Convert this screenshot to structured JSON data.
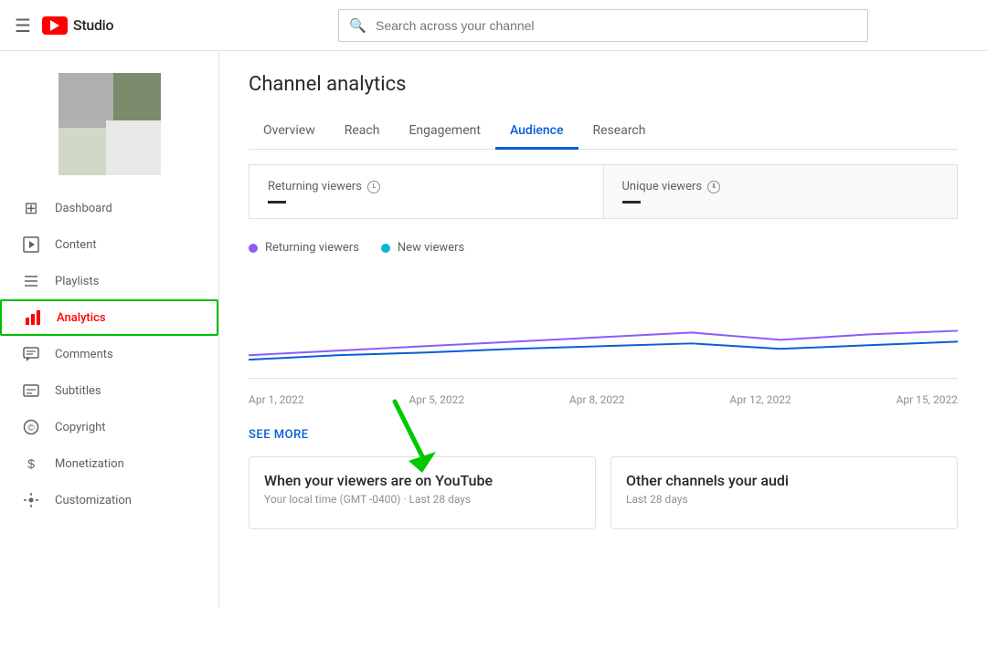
{
  "header": {
    "hamburger_label": "☰",
    "logo_text": "Studio",
    "search_placeholder": "Search across your channel"
  },
  "sidebar": {
    "nav_items": [
      {
        "id": "dashboard",
        "label": "Dashboard",
        "icon": "⊞",
        "active": false
      },
      {
        "id": "content",
        "label": "Content",
        "icon": "▷",
        "active": false
      },
      {
        "id": "playlists",
        "label": "Playlists",
        "icon": "≡",
        "active": false
      },
      {
        "id": "analytics",
        "label": "Analytics",
        "icon": "📊",
        "active": true
      },
      {
        "id": "comments",
        "label": "Comments",
        "icon": "💬",
        "active": false
      },
      {
        "id": "subtitles",
        "label": "Subtitles",
        "icon": "⊟",
        "active": false
      },
      {
        "id": "copyright",
        "label": "Copyright",
        "icon": "©",
        "active": false
      },
      {
        "id": "monetization",
        "label": "Monetization",
        "icon": "$",
        "active": false
      },
      {
        "id": "customization",
        "label": "Customization",
        "icon": "✦",
        "active": false
      }
    ]
  },
  "main": {
    "page_title": "Channel analytics",
    "tabs": [
      {
        "id": "overview",
        "label": "Overview",
        "active": false
      },
      {
        "id": "reach",
        "label": "Reach",
        "active": false
      },
      {
        "id": "engagement",
        "label": "Engagement",
        "active": false
      },
      {
        "id": "audience",
        "label": "Audience",
        "active": true
      },
      {
        "id": "research",
        "label": "Research",
        "active": false
      }
    ],
    "metrics": [
      {
        "label": "Returning viewers",
        "value": "—"
      },
      {
        "label": "Unique viewers",
        "value": "—"
      }
    ],
    "legend": [
      {
        "label": "Returning viewers",
        "color": "#8b5cf6"
      },
      {
        "label": "New viewers",
        "color": "#06b6d4"
      }
    ],
    "x_axis_labels": [
      "Apr 1, 2022",
      "Apr 5, 2022",
      "Apr 8, 2022",
      "Apr 12, 2022",
      "Apr 15, 2022"
    ],
    "see_more_label": "SEE MORE",
    "bottom_cards": [
      {
        "title": "When your viewers are on YouTube",
        "subtitle": "Your local time (GMT -0400) · Last 28 days"
      },
      {
        "title": "Other channels your audi",
        "subtitle": "Last 28 days"
      }
    ]
  }
}
